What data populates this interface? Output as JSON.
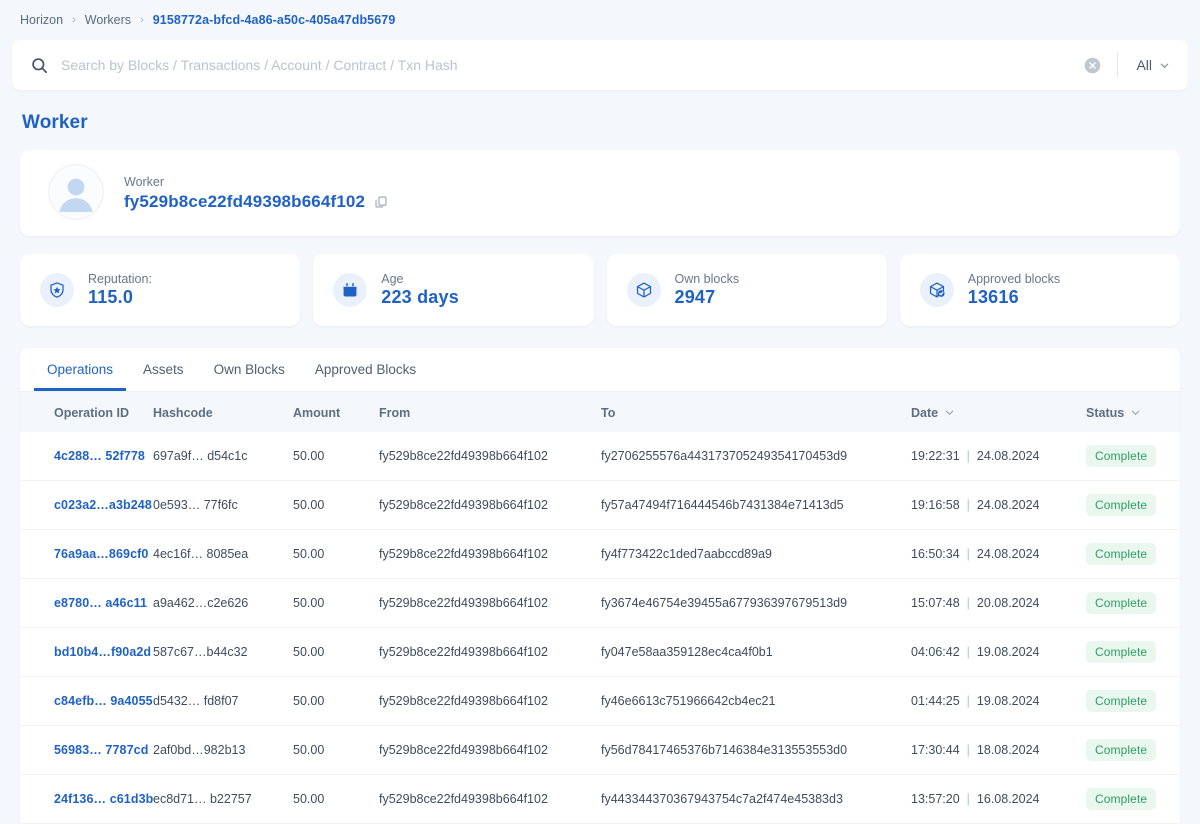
{
  "breadcrumb": {
    "items": [
      {
        "label": "Horizon",
        "active": false
      },
      {
        "label": "Workers",
        "active": false
      },
      {
        "label": "9158772a-bfcd-4a86-a50c-405a47db5679",
        "active": true
      }
    ],
    "separator": "›"
  },
  "search": {
    "placeholder": "Search by Blocks / Transactions / Account / Contract / Txn Hash",
    "value": "",
    "filter_label": "All"
  },
  "page": {
    "title": "Worker"
  },
  "worker": {
    "label": "Worker",
    "id": "fy529b8ce22fd49398b664f102"
  },
  "stats": [
    {
      "icon": "shield-star-icon",
      "label": "Reputation:",
      "value": "115.0"
    },
    {
      "icon": "calendar-icon",
      "label": "Age",
      "value": "223 days"
    },
    {
      "icon": "cube-icon",
      "label": "Own blocks",
      "value": "2947"
    },
    {
      "icon": "cube-check-icon",
      "label": "Approved blocks",
      "value": "13616"
    }
  ],
  "tabs": [
    {
      "label": "Operations",
      "active": true
    },
    {
      "label": "Assets",
      "active": false
    },
    {
      "label": "Own Blocks",
      "active": false
    },
    {
      "label": "Approved Blocks",
      "active": false
    }
  ],
  "table": {
    "columns": [
      {
        "label": "Operation ID",
        "sortable": false
      },
      {
        "label": "Hashcode",
        "sortable": false
      },
      {
        "label": "Amount",
        "sortable": false
      },
      {
        "label": "From",
        "sortable": false
      },
      {
        "label": "To",
        "sortable": false
      },
      {
        "label": "Date",
        "sortable": true
      },
      {
        "label": "Status",
        "sortable": true
      }
    ],
    "rows": [
      {
        "operation_id": "4c288… 52f778",
        "hashcode": "697a9f… d54c1c",
        "amount": "50.00",
        "from": "fy529b8ce22fd49398b664f102",
        "to": "fy2706255576a443173705249354170453d9",
        "time": "19:22:31",
        "date": "24.08.2024",
        "status": "Complete"
      },
      {
        "operation_id": "c023a2…a3b248",
        "hashcode": "0e593… 77f6fc",
        "amount": "50.00",
        "from": "fy529b8ce22fd49398b664f102",
        "to": "fy57a47494f716444546b7431384e71413d5",
        "time": "19:16:58",
        "date": "24.08.2024",
        "status": "Complete"
      },
      {
        "operation_id": "76a9aa…869cf0",
        "hashcode": "4ec16f… 8085ea",
        "amount": "50.00",
        "from": "fy529b8ce22fd49398b664f102",
        "to": "fy4f773422c1ded7aabccd89a9",
        "time": "16:50:34",
        "date": "24.08.2024",
        "status": "Complete"
      },
      {
        "operation_id": "e8780… a46c11",
        "hashcode": "a9a462…c2e626",
        "amount": "50.00",
        "from": "fy529b8ce22fd49398b664f102",
        "to": "fy3674e46754e39455a677936397679513d9",
        "time": "15:07:48",
        "date": "20.08.2024",
        "status": "Complete"
      },
      {
        "operation_id": "bd10b4…f90a2d",
        "hashcode": "587c67…b44c32",
        "amount": "50.00",
        "from": "fy529b8ce22fd49398b664f102",
        "to": "fy047e58aa359128ec4ca4f0b1",
        "time": "04:06:42",
        "date": "19.08.2024",
        "status": "Complete"
      },
      {
        "operation_id": "c84efb… 9a4055",
        "hashcode": "d5432… fd8f07",
        "amount": "50.00",
        "from": "fy529b8ce22fd49398b664f102",
        "to": "fy46e6613c751966642cb4ec21",
        "time": "01:44:25",
        "date": "19.08.2024",
        "status": "Complete"
      },
      {
        "operation_id": "56983… 7787cd",
        "hashcode": "2af0bd…982b13",
        "amount": "50.00",
        "from": "fy529b8ce22fd49398b664f102",
        "to": "fy56d78417465376b7146384e313553553d0",
        "time": "17:30:44",
        "date": "18.08.2024",
        "status": "Complete"
      },
      {
        "operation_id": "24f136… c61d3b",
        "hashcode": "ec8d71… b22757",
        "amount": "50.00",
        "from": "fy529b8ce22fd49398b664f102",
        "to": "fy443344370367943754c7a2f474e45383d3",
        "time": "13:57:20",
        "date": "16.08.2024",
        "status": "Complete"
      }
    ]
  },
  "colors": {
    "accent": "#1f62c4",
    "page_bg": "#f4f7fb",
    "status_text": "#2e9e63",
    "status_bg": "#e9f7ef"
  }
}
